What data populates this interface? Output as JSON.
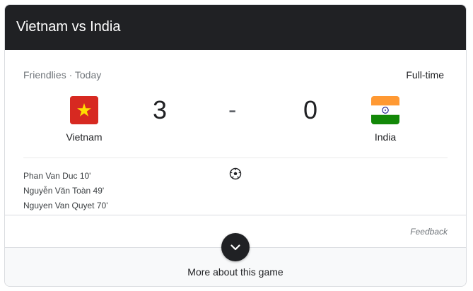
{
  "header": {
    "title": "Vietnam vs India"
  },
  "match": {
    "competition": "Friendlies · Today",
    "status": "Full-time",
    "home": {
      "name": "Vietnam",
      "score": "3",
      "flag": "vietnam-flag"
    },
    "away": {
      "name": "India",
      "score": "0",
      "flag": "india-flag"
    },
    "separator": "-",
    "goals_home": [
      "Phan Van Duc 10'",
      "Nguyễn Văn Toàn 49'",
      "Nguyen Van Quyet 70'"
    ]
  },
  "footer": {
    "feedback": "Feedback",
    "more_label": "More about this game"
  },
  "colors": {
    "header_bg": "#202124",
    "vietnam_red": "#d72921",
    "vietnam_star": "#ffde00",
    "india_saffron": "#ff9933",
    "india_green": "#138808",
    "india_chakra": "#000080"
  }
}
